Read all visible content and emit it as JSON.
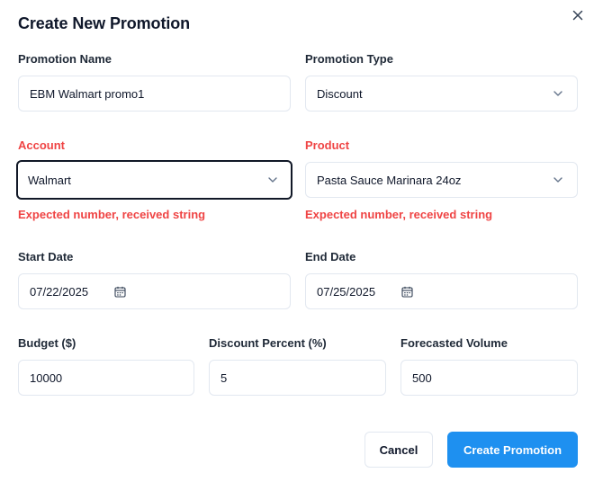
{
  "dialog": {
    "title": "Create New Promotion",
    "close_icon": "close-icon"
  },
  "form": {
    "promotion_name": {
      "label": "Promotion Name",
      "value": "EBM Walmart promo1"
    },
    "promotion_type": {
      "label": "Promotion Type",
      "value": "Discount",
      "icon": "chevron-down-icon"
    },
    "account": {
      "label": "Account",
      "value": "Walmart",
      "error": "Expected number, received string",
      "icon": "chevron-down-icon"
    },
    "product": {
      "label": "Product",
      "value": "Pasta Sauce Marinara 24oz",
      "error": "Expected number, received string",
      "icon": "chevron-down-icon"
    },
    "start_date": {
      "label": "Start Date",
      "value": "07/22/2025",
      "icon": "calendar-icon"
    },
    "end_date": {
      "label": "End Date",
      "value": "07/25/2025",
      "icon": "calendar-icon"
    },
    "budget": {
      "label": "Budget ($)",
      "value": "10000"
    },
    "discount_percent": {
      "label": "Discount Percent (%)",
      "value": "5"
    },
    "forecasted_volume": {
      "label": "Forecasted Volume",
      "value": "500"
    }
  },
  "actions": {
    "cancel_label": "Cancel",
    "submit_label": "Create Promotion"
  },
  "colors": {
    "error": "#ef4444",
    "primary": "#1e90f0",
    "border": "#e2e8f0",
    "focus_border": "#111827"
  }
}
